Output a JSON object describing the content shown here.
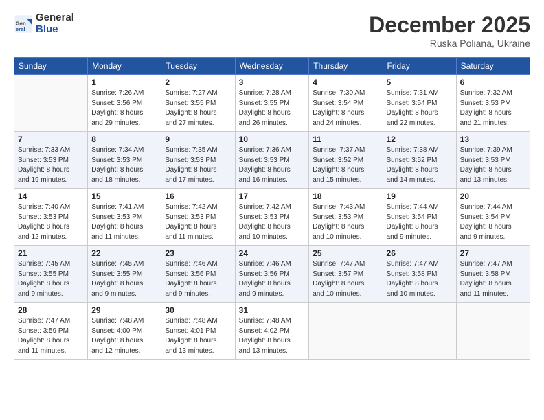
{
  "header": {
    "logo_line1": "General",
    "logo_line2": "Blue",
    "month": "December 2025",
    "location": "Ruska Poliana, Ukraine"
  },
  "weekdays": [
    "Sunday",
    "Monday",
    "Tuesday",
    "Wednesday",
    "Thursday",
    "Friday",
    "Saturday"
  ],
  "weeks": [
    [
      {
        "day": "",
        "info": ""
      },
      {
        "day": "1",
        "info": "Sunrise: 7:26 AM\nSunset: 3:56 PM\nDaylight: 8 hours\nand 29 minutes."
      },
      {
        "day": "2",
        "info": "Sunrise: 7:27 AM\nSunset: 3:55 PM\nDaylight: 8 hours\nand 27 minutes."
      },
      {
        "day": "3",
        "info": "Sunrise: 7:28 AM\nSunset: 3:55 PM\nDaylight: 8 hours\nand 26 minutes."
      },
      {
        "day": "4",
        "info": "Sunrise: 7:30 AM\nSunset: 3:54 PM\nDaylight: 8 hours\nand 24 minutes."
      },
      {
        "day": "5",
        "info": "Sunrise: 7:31 AM\nSunset: 3:54 PM\nDaylight: 8 hours\nand 22 minutes."
      },
      {
        "day": "6",
        "info": "Sunrise: 7:32 AM\nSunset: 3:53 PM\nDaylight: 8 hours\nand 21 minutes."
      }
    ],
    [
      {
        "day": "7",
        "info": "Sunrise: 7:33 AM\nSunset: 3:53 PM\nDaylight: 8 hours\nand 19 minutes."
      },
      {
        "day": "8",
        "info": "Sunrise: 7:34 AM\nSunset: 3:53 PM\nDaylight: 8 hours\nand 18 minutes."
      },
      {
        "day": "9",
        "info": "Sunrise: 7:35 AM\nSunset: 3:53 PM\nDaylight: 8 hours\nand 17 minutes."
      },
      {
        "day": "10",
        "info": "Sunrise: 7:36 AM\nSunset: 3:53 PM\nDaylight: 8 hours\nand 16 minutes."
      },
      {
        "day": "11",
        "info": "Sunrise: 7:37 AM\nSunset: 3:52 PM\nDaylight: 8 hours\nand 15 minutes."
      },
      {
        "day": "12",
        "info": "Sunrise: 7:38 AM\nSunset: 3:52 PM\nDaylight: 8 hours\nand 14 minutes."
      },
      {
        "day": "13",
        "info": "Sunrise: 7:39 AM\nSunset: 3:53 PM\nDaylight: 8 hours\nand 13 minutes."
      }
    ],
    [
      {
        "day": "14",
        "info": "Sunrise: 7:40 AM\nSunset: 3:53 PM\nDaylight: 8 hours\nand 12 minutes."
      },
      {
        "day": "15",
        "info": "Sunrise: 7:41 AM\nSunset: 3:53 PM\nDaylight: 8 hours\nand 11 minutes."
      },
      {
        "day": "16",
        "info": "Sunrise: 7:42 AM\nSunset: 3:53 PM\nDaylight: 8 hours\nand 11 minutes."
      },
      {
        "day": "17",
        "info": "Sunrise: 7:42 AM\nSunset: 3:53 PM\nDaylight: 8 hours\nand 10 minutes."
      },
      {
        "day": "18",
        "info": "Sunrise: 7:43 AM\nSunset: 3:53 PM\nDaylight: 8 hours\nand 10 minutes."
      },
      {
        "day": "19",
        "info": "Sunrise: 7:44 AM\nSunset: 3:54 PM\nDaylight: 8 hours\nand 9 minutes."
      },
      {
        "day": "20",
        "info": "Sunrise: 7:44 AM\nSunset: 3:54 PM\nDaylight: 8 hours\nand 9 minutes."
      }
    ],
    [
      {
        "day": "21",
        "info": "Sunrise: 7:45 AM\nSunset: 3:55 PM\nDaylight: 8 hours\nand 9 minutes."
      },
      {
        "day": "22",
        "info": "Sunrise: 7:45 AM\nSunset: 3:55 PM\nDaylight: 8 hours\nand 9 minutes."
      },
      {
        "day": "23",
        "info": "Sunrise: 7:46 AM\nSunset: 3:56 PM\nDaylight: 8 hours\nand 9 minutes."
      },
      {
        "day": "24",
        "info": "Sunrise: 7:46 AM\nSunset: 3:56 PM\nDaylight: 8 hours\nand 9 minutes."
      },
      {
        "day": "25",
        "info": "Sunrise: 7:47 AM\nSunset: 3:57 PM\nDaylight: 8 hours\nand 10 minutes."
      },
      {
        "day": "26",
        "info": "Sunrise: 7:47 AM\nSunset: 3:58 PM\nDaylight: 8 hours\nand 10 minutes."
      },
      {
        "day": "27",
        "info": "Sunrise: 7:47 AM\nSunset: 3:58 PM\nDaylight: 8 hours\nand 11 minutes."
      }
    ],
    [
      {
        "day": "28",
        "info": "Sunrise: 7:47 AM\nSunset: 3:59 PM\nDaylight: 8 hours\nand 11 minutes."
      },
      {
        "day": "29",
        "info": "Sunrise: 7:48 AM\nSunset: 4:00 PM\nDaylight: 8 hours\nand 12 minutes."
      },
      {
        "day": "30",
        "info": "Sunrise: 7:48 AM\nSunset: 4:01 PM\nDaylight: 8 hours\nand 13 minutes."
      },
      {
        "day": "31",
        "info": "Sunrise: 7:48 AM\nSunset: 4:02 PM\nDaylight: 8 hours\nand 13 minutes."
      },
      {
        "day": "",
        "info": ""
      },
      {
        "day": "",
        "info": ""
      },
      {
        "day": "",
        "info": ""
      }
    ]
  ]
}
